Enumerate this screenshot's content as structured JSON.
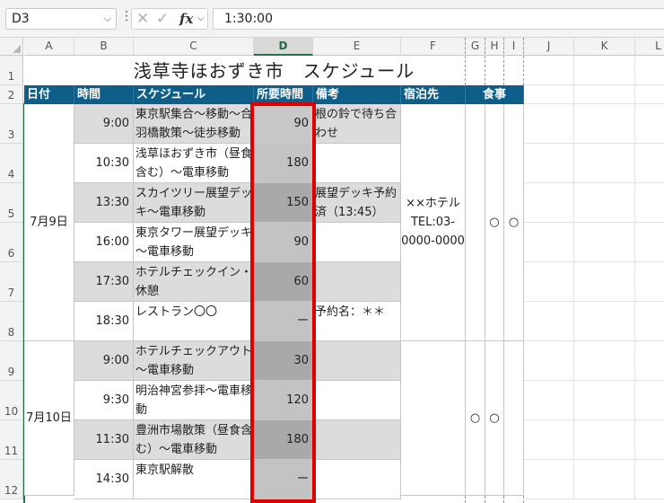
{
  "formula_bar": {
    "name_box": "D3",
    "formula": "1:30:00"
  },
  "columns": [
    "A",
    "B",
    "C",
    "D",
    "E",
    "F",
    "G",
    "H",
    "I",
    "J",
    "K",
    "L"
  ],
  "rows": [
    "1",
    "2",
    "3",
    "4",
    "5",
    "6",
    "7",
    "8",
    "9",
    "10",
    "11",
    "12"
  ],
  "sheet": {
    "title": "浅草寺ほおずき市　スケジュール",
    "headers": {
      "date": "日付",
      "time": "時間",
      "schedule": "スケジュール",
      "duration": "所要時間",
      "notes": "備考",
      "lodging": "宿泊先",
      "meals": "食事"
    },
    "days": [
      {
        "date": "7月9日",
        "lodging": "××ホテル\nTEL:03-\n0000-0000",
        "meals": [
          "",
          "○",
          "○"
        ]
      },
      {
        "date": "7月10日",
        "lodging": "",
        "meals": [
          "○",
          "○",
          ""
        ]
      }
    ],
    "items": [
      {
        "time": "9:00",
        "schedule": "東京駅集合〜移動〜合\n羽橋散策〜徒歩移動",
        "duration": "90",
        "note": "根の鈴で待ち合\nわせ"
      },
      {
        "time": "10:30",
        "schedule": "浅草ほおずき市（昼食\n含む）〜電車移動",
        "duration": "180",
        "note": ""
      },
      {
        "time": "13:30",
        "schedule": "スカイツリー展望デッ\nキ〜電車移動",
        "duration": "150",
        "note": "展望デッキ予約\n済（13:45）"
      },
      {
        "time": "16:00",
        "schedule": "東京タワー展望デッキ\n〜電車移動",
        "duration": "90",
        "note": ""
      },
      {
        "time": "17:30",
        "schedule": "ホテルチェックイン・\n休憩",
        "duration": "60",
        "note": ""
      },
      {
        "time": "18:30",
        "schedule": "レストラン〇〇",
        "duration": "ー",
        "note": "予約名：＊＊"
      },
      {
        "time": "9:00",
        "schedule": "ホテルチェックアウト\n〜電車移動",
        "duration": "30",
        "note": ""
      },
      {
        "time": "9:30",
        "schedule": "明治神宮参拝〜電車移\n動",
        "duration": "120",
        "note": ""
      },
      {
        "time": "11:30",
        "schedule": "豊洲市場散策（昼食含\nむ）〜電車移動",
        "duration": "180",
        "note": ""
      },
      {
        "time": "14:30",
        "schedule": "東京駅解散",
        "duration": "ー",
        "note": ""
      }
    ]
  }
}
